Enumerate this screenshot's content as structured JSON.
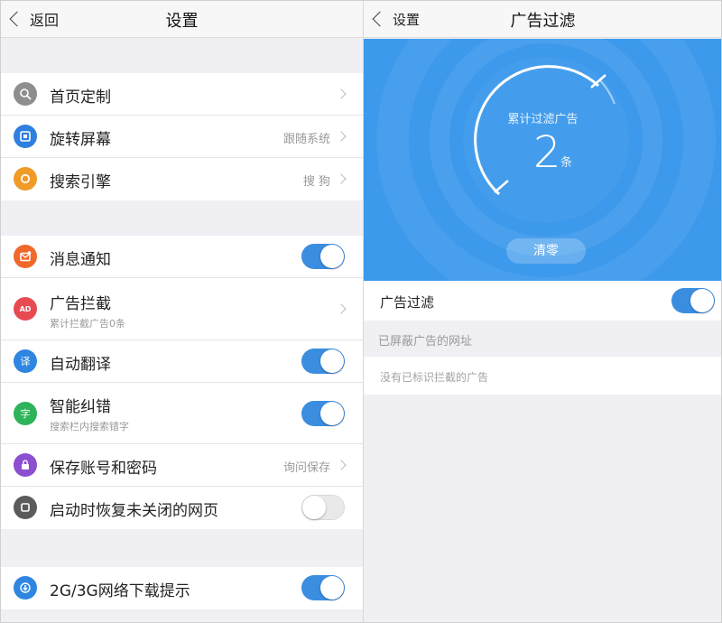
{
  "left": {
    "back_label": "返回",
    "title": "设置",
    "groups": [
      {
        "items": [
          {
            "label": "首页定制",
            "icon": "search-settings-icon",
            "color": "#8e8e8e"
          },
          {
            "label": "旋转屏幕",
            "value": "跟随系统",
            "icon": "rotate-screen-icon",
            "color": "#2f7fe0"
          },
          {
            "label": "搜索引擎",
            "value": "搜 狗",
            "icon": "search-engine-icon",
            "color": "#f09a28"
          }
        ]
      },
      {
        "items": [
          {
            "label": "消息通知",
            "toggle": "on",
            "icon": "message-notification-icon",
            "color": "#f0682a"
          },
          {
            "label": "广告拦截",
            "sub": "累计拦截广告0条",
            "icon": "ad-block-icon",
            "icon_text": "AD",
            "color": "#e84a52"
          },
          {
            "label": "自动翻译",
            "toggle": "on",
            "icon": "translate-icon",
            "icon_text": "译",
            "color": "#2e86e0"
          },
          {
            "label": "智能纠错",
            "sub": "搜索栏内搜索错字",
            "toggle": "on",
            "icon": "smart-correct-icon",
            "icon_text": "字",
            "color": "#2fb35a"
          },
          {
            "label": "保存账号和密码",
            "value": "询问保存",
            "icon": "lock-icon",
            "color": "#8b4fd0"
          },
          {
            "label": "启动时恢复未关闭的网页",
            "toggle": "off",
            "icon": "restore-pages-icon",
            "color": "#5b5b5b"
          }
        ]
      },
      {
        "items": [
          {
            "label": "2G/3G网络下载提示",
            "toggle": "on",
            "icon": "download-hint-icon",
            "color": "#2e86e0"
          }
        ]
      }
    ]
  },
  "right": {
    "back_label": "设置",
    "title": "广告过滤",
    "stat_label": "累计过滤广告",
    "stat_value": "2",
    "stat_unit": "条",
    "clear_label": "清零",
    "filter_label": "广告过滤",
    "filter_toggle": "on",
    "section_header": "已屏蔽广告的网址",
    "empty_text": "没有已标识拦截的广告"
  },
  "colors": {
    "accent": "#3b8de0",
    "hero_bg": "#3d99ec",
    "page_bg": "#efeff4"
  }
}
